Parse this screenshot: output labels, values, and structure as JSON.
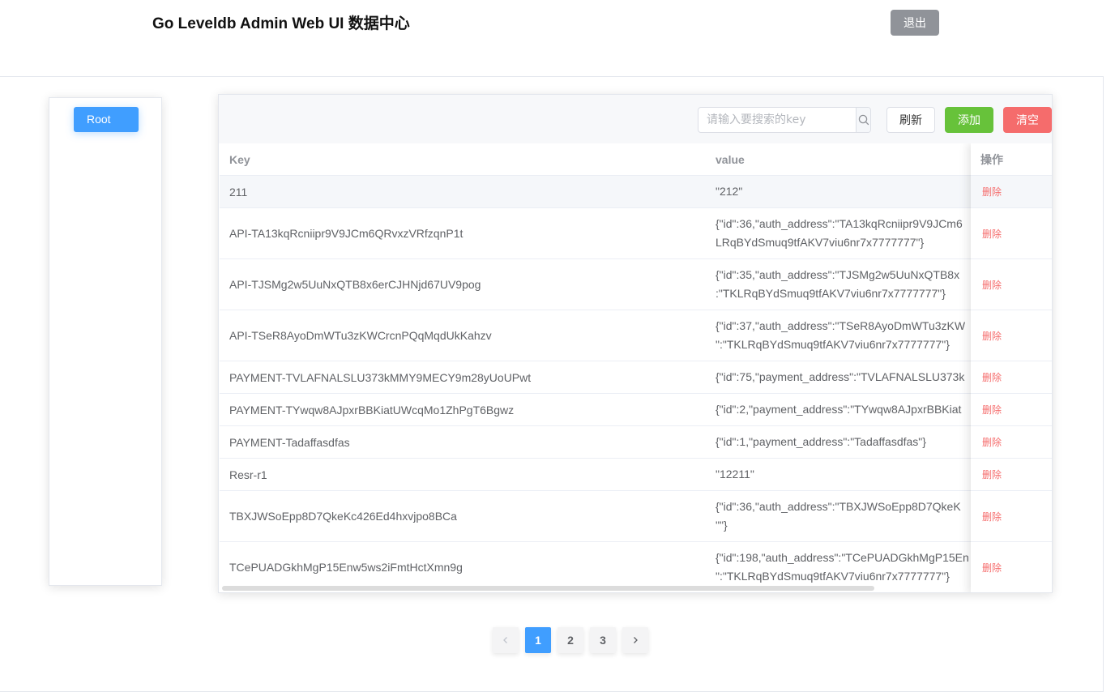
{
  "header": {
    "title": "Go Leveldb Admin Web UI 数据中心",
    "logout_label": "退出"
  },
  "sidebar": {
    "root_label": "Root"
  },
  "toolbar": {
    "search_placeholder": "请输入要搜索的key",
    "search_icon": "search-icon",
    "refresh_label": "刷新",
    "add_label": "添加",
    "clear_label": "清空"
  },
  "table": {
    "columns": {
      "key": "Key",
      "value": "value",
      "action": "操作"
    },
    "rows": [
      {
        "key": "211",
        "value_lines": [
          "\"212\""
        ],
        "action": "删除"
      },
      {
        "key": "API-TA13kqRcniipr9V9JCm6QRvxzVRfzqnP1t",
        "value_lines": [
          "{\"id\":36,\"auth_address\":\"TA13kqRcniipr9V9JCm6",
          "LRqBYdSmuq9tfAKV7viu6nr7x7777777\"}"
        ],
        "action": "删除"
      },
      {
        "key": "API-TJSMg2w5UuNxQTB8x6erCJHNjd67UV9pog",
        "value_lines": [
          "{\"id\":35,\"auth_address\":\"TJSMg2w5UuNxQTB8x",
          ":\"TKLRqBYdSmuq9tfAKV7viu6nr7x7777777\"}"
        ],
        "action": "删除"
      },
      {
        "key": "API-TSeR8AyoDmWTu3zKWCrcnPQqMqdUkKahzv",
        "value_lines": [
          "{\"id\":37,\"auth_address\":\"TSeR8AyoDmWTu3zKW",
          "\":\"TKLRqBYdSmuq9tfAKV7viu6nr7x7777777\"}"
        ],
        "action": "删除"
      },
      {
        "key": "PAYMENT-TVLAFNALSLU373kMMY9MECY9m28yUoUPwt",
        "value_lines": [
          "{\"id\":75,\"payment_address\":\"TVLAFNALSLU373k"
        ],
        "action": "删除"
      },
      {
        "key": "PAYMENT-TYwqw8AJpxrBBKiatUWcqMo1ZhPgT6Bgwz",
        "value_lines": [
          "{\"id\":2,\"payment_address\":\"TYwqw8AJpxrBBKiat"
        ],
        "action": "删除"
      },
      {
        "key": "PAYMENT-Tadaffasdfas",
        "value_lines": [
          "{\"id\":1,\"payment_address\":\"Tadaffasdfas\"}"
        ],
        "action": "删除"
      },
      {
        "key": "Resr-r1",
        "value_lines": [
          "\"12211\""
        ],
        "action": "删除"
      },
      {
        "key": "TBXJWSoEpp8D7QkeKc426Ed4hxvjpo8BCa",
        "value_lines": [
          "{\"id\":36,\"auth_address\":\"TBXJWSoEpp8D7QkeK",
          "\"\"}"
        ],
        "action": "删除"
      },
      {
        "key": "TCePUADGkhMgP15Enw5ws2iFmtHctXmn9g",
        "value_lines": [
          "{\"id\":198,\"auth_address\":\"TCePUADGkhMgP15En",
          "\":\"TKLRqBYdSmuq9tfAKV7viu6nr7x7777777\"}"
        ],
        "action": "删除"
      }
    ]
  },
  "pagination": {
    "prev_icon": "chevron-left-icon",
    "next_icon": "chevron-right-icon",
    "pages": [
      "1",
      "2",
      "3"
    ],
    "current": "1"
  }
}
